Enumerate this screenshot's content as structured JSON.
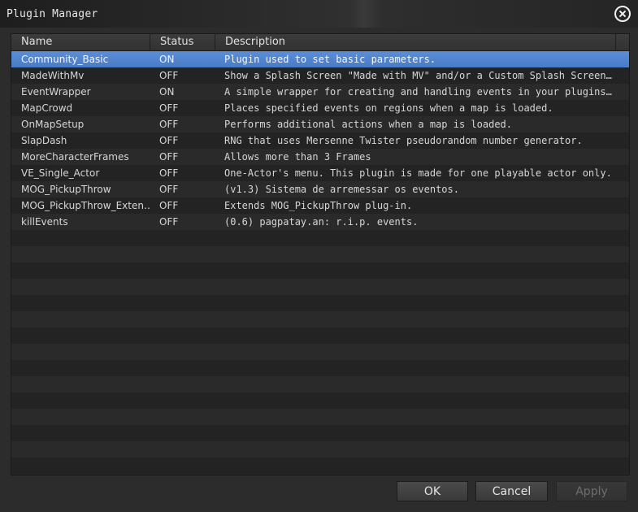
{
  "window": {
    "title": "Plugin Manager",
    "close_icon": "close-circle-icon"
  },
  "table": {
    "columns": [
      "Name",
      "Status",
      "Description"
    ],
    "rows": [
      {
        "name": "Community_Basic",
        "status": "ON",
        "description": "Plugin used to set basic parameters."
      },
      {
        "name": "MadeWithMv",
        "status": "OFF",
        "description": "Show a Splash Screen \"Made with MV\" and/or a Custom Splash Screen be…"
      },
      {
        "name": "EventWrapper",
        "status": "ON",
        "description": "A simple wrapper for creating and handling events in your plugins. P…"
      },
      {
        "name": "MapCrowd",
        "status": "OFF",
        "description": "Places specified events on regions when a map is loaded."
      },
      {
        "name": "OnMapSetup",
        "status": "OFF",
        "description": "Performs additional actions when a map is loaded."
      },
      {
        "name": "SlapDash",
        "status": "OFF",
        "description": "RNG that uses Mersenne Twister pseudorandom number generator."
      },
      {
        "name": "MoreCharacterFrames",
        "status": "OFF",
        "description": "Allows more than 3 Frames"
      },
      {
        "name": "VE_Single_Actor",
        "status": "OFF",
        "description": "One-Actor's menu. This plugin is made for one playable actor only."
      },
      {
        "name": "MOG_PickupThrow",
        "status": "OFF",
        "description": "(v1.3) Sistema de arremessar os eventos."
      },
      {
        "name": "MOG_PickupThrow_Exten…",
        "status": "OFF",
        "description": "Extends MOG_PickupThrow plug-in."
      },
      {
        "name": "killEvents",
        "status": "OFF",
        "description": "(0.6) pagpatay.an: r.i.p. events."
      }
    ],
    "selected_index": 0
  },
  "buttons": {
    "ok": "OK",
    "cancel": "Cancel",
    "apply": "Apply"
  },
  "colors": {
    "selection": "#4a7cc6",
    "background": "#2c2c2c"
  }
}
